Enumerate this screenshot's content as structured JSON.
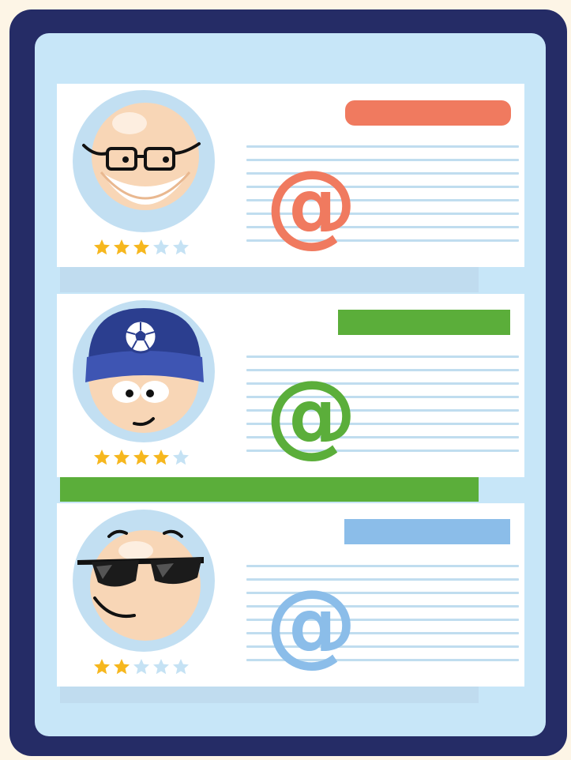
{
  "profiles": [
    {
      "avatar_icon": "bald-man-glasses-avatar-icon",
      "rating": 3,
      "rating_max": 5,
      "accent_color": "#f07a5f",
      "contact_icon": "at-sign-icon",
      "contact_symbol": "@"
    },
    {
      "avatar_icon": "soccer-cap-avatar-icon",
      "rating": 4,
      "rating_max": 5,
      "accent_color": "#5bae3a",
      "contact_icon": "at-sign-icon",
      "contact_symbol": "@"
    },
    {
      "avatar_icon": "sunglasses-avatar-icon",
      "rating": 2,
      "rating_max": 5,
      "accent_color": "#8bbde9",
      "contact_icon": "at-sign-icon",
      "contact_symbol": "@"
    }
  ],
  "colors": {
    "frame": "#252c66",
    "screen": "#c7e6f8",
    "card": "#ffffff",
    "star_on": "#f6b71e",
    "star_off": "#c5e2f4",
    "text_line": "#c0ddef"
  }
}
